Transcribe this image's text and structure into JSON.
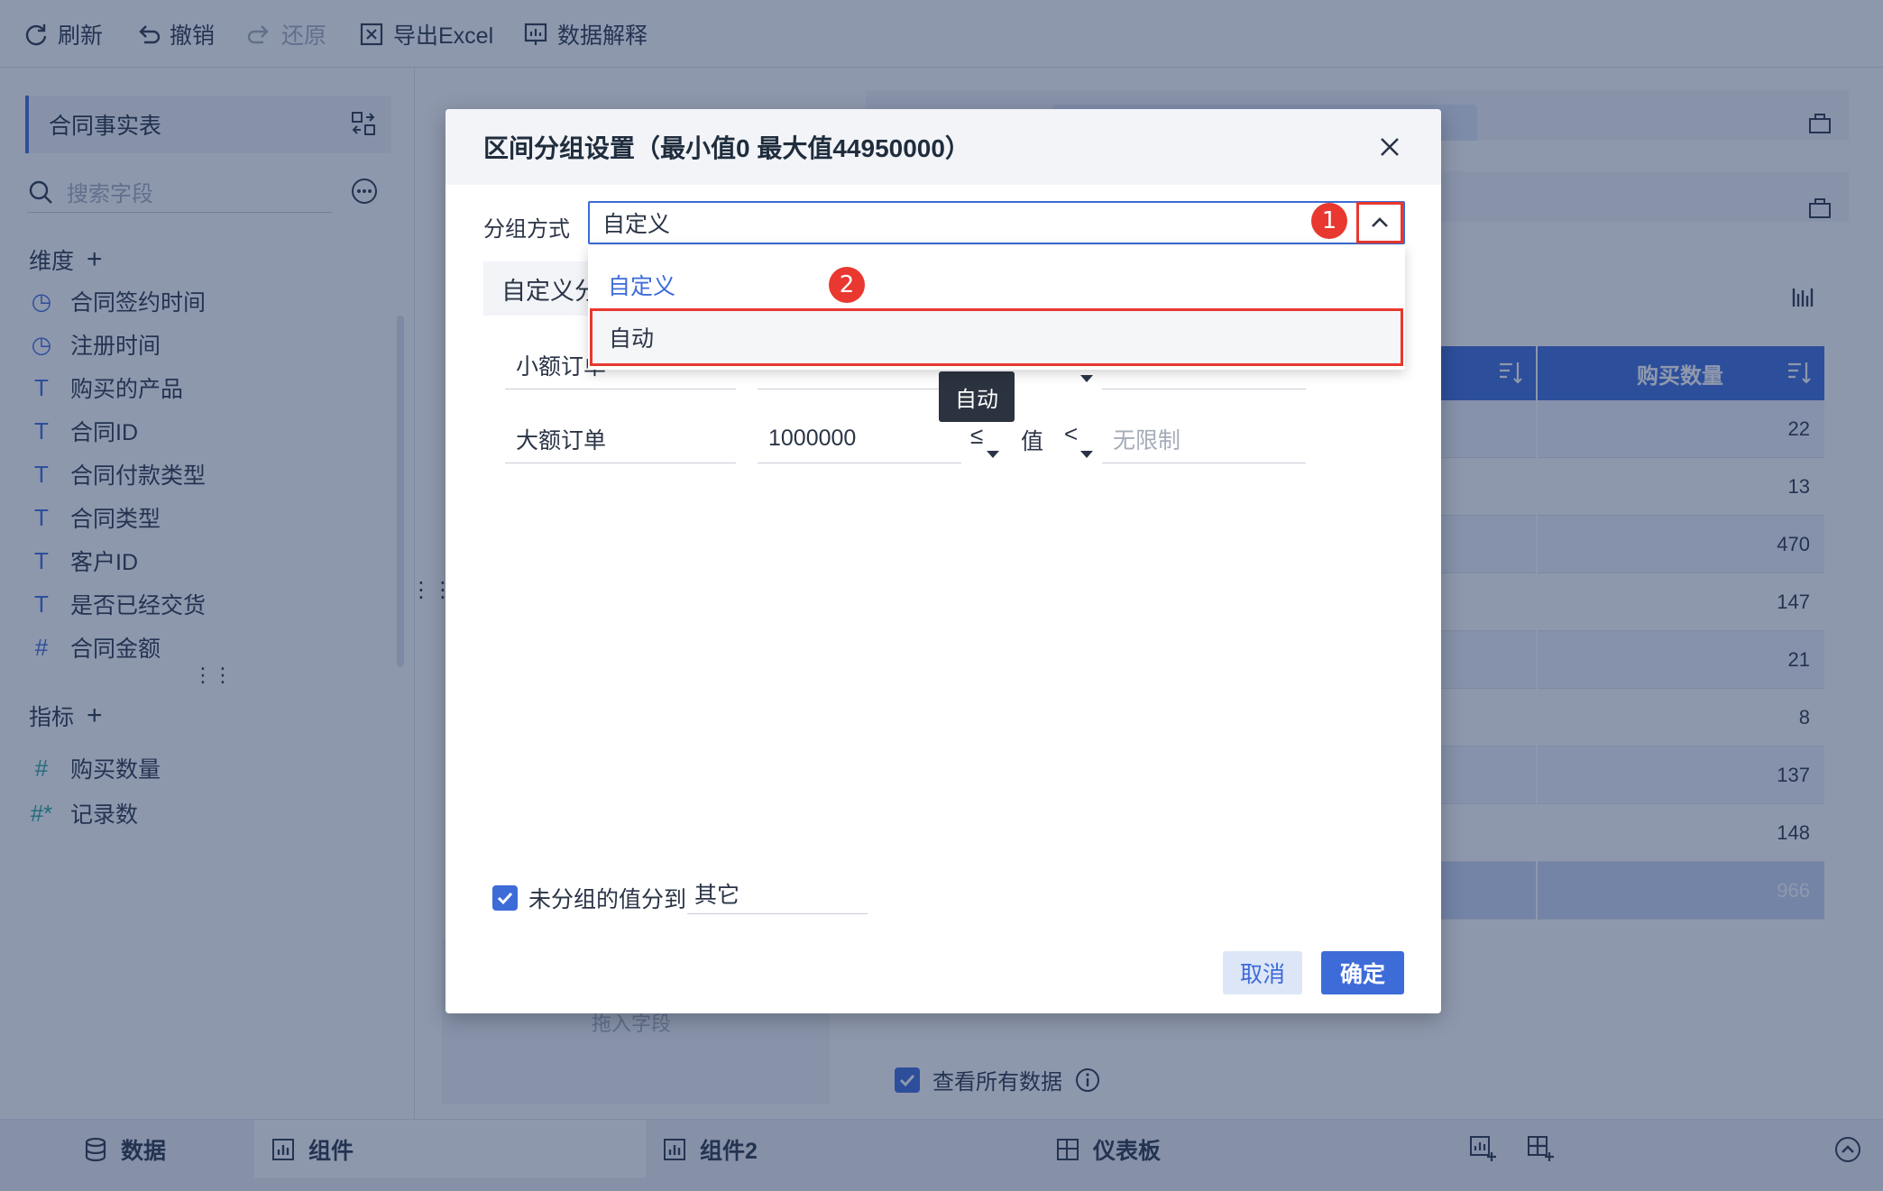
{
  "toolbar": {
    "refresh": "刷新",
    "undo": "撤销",
    "redo": "还原",
    "export": "导出Excel",
    "explain": "数据解释"
  },
  "sidebar": {
    "table_name": "合同事实表",
    "search_placeholder": "搜索字段",
    "dimension_title": "维度",
    "dimensions": [
      {
        "label": "合同签约时间",
        "icon": "clock-icon"
      },
      {
        "label": "注册时间",
        "icon": "clock-icon"
      },
      {
        "label": "购买的产品",
        "icon": "text-icon"
      },
      {
        "label": "合同ID",
        "icon": "text-icon"
      },
      {
        "label": "合同付款类型",
        "icon": "text-icon"
      },
      {
        "label": "合同类型",
        "icon": "text-icon"
      },
      {
        "label": "客户ID",
        "icon": "text-icon"
      },
      {
        "label": "是否已经交货",
        "icon": "text-icon"
      },
      {
        "label": "合同金额",
        "icon": "hash-icon"
      }
    ],
    "measure_title": "指标",
    "measures": [
      {
        "label": "购买数量",
        "icon": "hash-icon"
      },
      {
        "label": "记录数",
        "icon": "hash-star-icon"
      }
    ]
  },
  "grid": {
    "column_header": "购买数量",
    "values": [
      "22",
      "13",
      "470",
      "147",
      "21",
      "8",
      "137",
      "148",
      "966"
    ]
  },
  "right_panel": {
    "view_all_label": "查看所有数据"
  },
  "mid_panel": {
    "drop_hint": "拖入字段"
  },
  "bottom_tabs": {
    "data": "数据",
    "component": "组件",
    "component2": "组件2",
    "dashboard": "仪表板"
  },
  "dialog": {
    "title": "区间分组设置（最小值0 最大值44950000）",
    "group_mode_label": "分组方式",
    "group_mode_value": "自定义",
    "custom_tab": "自定义分",
    "options": [
      "自定义",
      "自动"
    ],
    "rows": [
      {
        "name": "小额订单"
      },
      {
        "name": "大额订单",
        "min": "1000000",
        "op1": "≤",
        "value_label": "值",
        "op2": "<",
        "max_placeholder": "无限制"
      }
    ],
    "tooltip": "自动",
    "ungrouped_label": "未分组的值分到",
    "ungrouped_value": "其它",
    "cancel": "取消",
    "confirm": "确定"
  },
  "badges": [
    "1",
    "2"
  ],
  "colors": {
    "accent": "#3d6bd8",
    "highlight_border": "#e8382f",
    "overlay": "#1d325c"
  }
}
